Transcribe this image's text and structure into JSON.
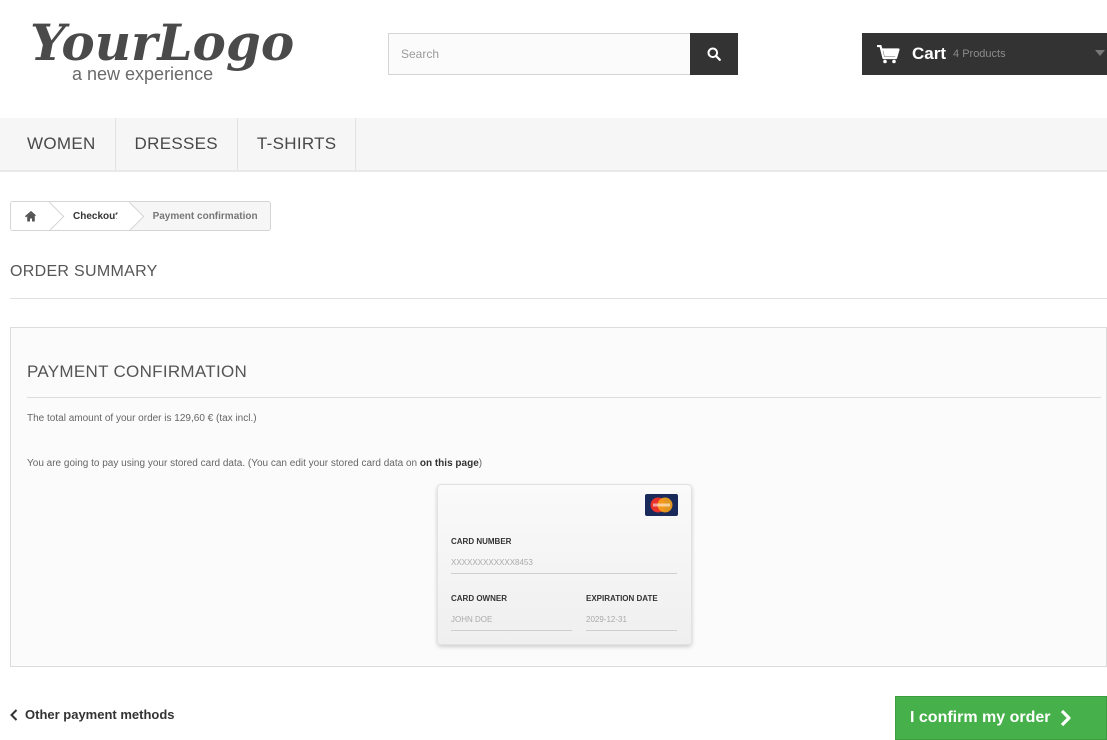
{
  "header": {
    "logo": {
      "main": "YourLogo",
      "tagline": "a new experience"
    },
    "search": {
      "placeholder": "Search",
      "icon": "search-icon"
    },
    "cart": {
      "label": "Cart",
      "count": "4 Products",
      "icon": "shopping-cart-icon"
    }
  },
  "nav": {
    "items": [
      {
        "label": "WOMEN"
      },
      {
        "label": "DRESSES"
      },
      {
        "label": "T-SHIRTS"
      }
    ]
  },
  "breadcrumb": {
    "home_icon": "home-icon",
    "items": [
      {
        "label": "Checkout"
      },
      {
        "label": "Payment confirmation"
      }
    ]
  },
  "order_summary": {
    "title": "ORDER SUMMARY"
  },
  "payment": {
    "title": "PAYMENT CONFIRMATION",
    "total_text": "The total amount of your order is 129,60 € (tax incl.)",
    "pay_text_before": "You are going to pay using your stored card data. (You can edit your stored card data on ",
    "pay_link": "on this page",
    "pay_text_after": ")",
    "card": {
      "brand_icon": "mastercard-icon",
      "number_label": "CARD NUMBER",
      "number_value": "XXXXXXXXXXXX8453",
      "owner_label": "CARD OWNER",
      "owner_value": "JOHN DOE",
      "expiry_label": "EXPIRATION DATE",
      "expiry_value": "2029-12-31"
    }
  },
  "actions": {
    "back_label": "Other payment methods",
    "confirm_label": "I confirm my order"
  },
  "colors": {
    "dark": "#333333",
    "confirm_green": "#46b04a",
    "nav_bg": "#f6f6f6"
  }
}
